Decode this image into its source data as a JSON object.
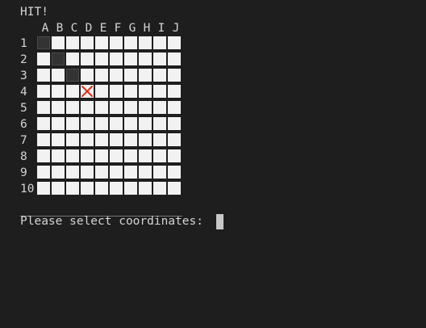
{
  "status": "HIT!",
  "columns": [
    "A",
    "B",
    "C",
    "D",
    "E",
    "F",
    "G",
    "H",
    "I",
    "J"
  ],
  "rows": [
    "1",
    "2",
    "3",
    "4",
    "5",
    "6",
    "7",
    "8",
    "9",
    "10"
  ],
  "cells": [
    [
      "selected",
      "empty",
      "empty",
      "empty",
      "empty",
      "empty",
      "empty",
      "empty",
      "empty",
      "empty"
    ],
    [
      "empty",
      "selected",
      "empty",
      "empty",
      "empty",
      "empty",
      "empty",
      "empty",
      "empty",
      "empty"
    ],
    [
      "empty",
      "empty",
      "selected",
      "empty",
      "empty",
      "empty",
      "empty",
      "empty",
      "empty",
      "empty"
    ],
    [
      "empty",
      "empty",
      "empty",
      "hit",
      "empty",
      "empty",
      "empty",
      "empty",
      "empty",
      "empty"
    ],
    [
      "empty",
      "empty",
      "empty",
      "empty",
      "empty",
      "empty",
      "empty",
      "empty",
      "empty",
      "empty"
    ],
    [
      "empty",
      "empty",
      "empty",
      "empty",
      "empty",
      "empty",
      "empty",
      "empty",
      "empty",
      "empty"
    ],
    [
      "empty",
      "empty",
      "empty",
      "empty",
      "empty",
      "empty",
      "empty",
      "empty",
      "empty",
      "empty"
    ],
    [
      "empty",
      "empty",
      "empty",
      "empty",
      "empty",
      "empty",
      "empty",
      "empty",
      "empty",
      "empty"
    ],
    [
      "empty",
      "empty",
      "empty",
      "empty",
      "empty",
      "empty",
      "empty",
      "empty",
      "empty",
      "empty"
    ],
    [
      "empty",
      "empty",
      "empty",
      "empty",
      "empty",
      "empty",
      "empty",
      "empty",
      "empty",
      "empty"
    ]
  ],
  "hit_mark_icon": "cross-icon",
  "divider": "_______________________",
  "prompt": "Please select coordinates: ",
  "colors": {
    "background": "#1e1e1e",
    "text": "#d4d4d4",
    "cell_empty": "#f2f2f2",
    "cell_selected": "#333333",
    "hit_mark": "#e0301e"
  }
}
